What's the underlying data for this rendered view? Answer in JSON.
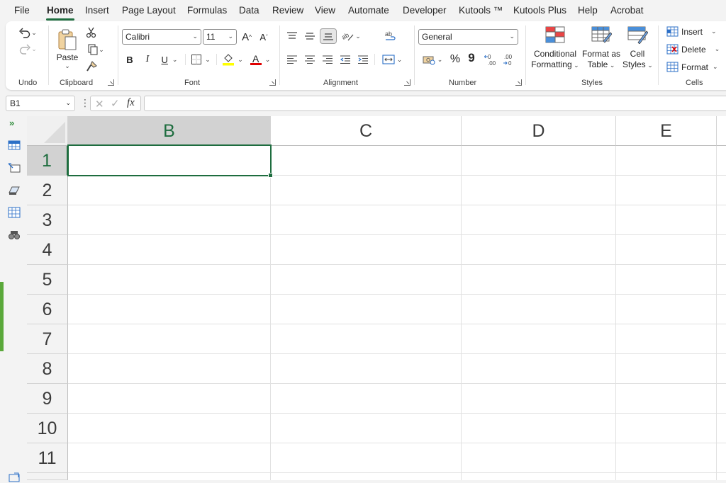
{
  "menu": {
    "tabs": [
      "File",
      "Home",
      "Insert",
      "Page Layout",
      "Formulas",
      "Data",
      "Review",
      "View",
      "Automate",
      "Developer",
      "Kutools ™",
      "Kutools Plus",
      "Help",
      "Acrobat"
    ],
    "active": "Home"
  },
  "ribbon": {
    "groups": {
      "undo": "Undo",
      "clipboard": "Clipboard",
      "font": "Font",
      "alignment": "Alignment",
      "number": "Number",
      "styles": "Styles",
      "cells": "Cells"
    },
    "clipboard": {
      "paste_label": "Paste"
    },
    "font": {
      "name": "Calibri",
      "size": "11",
      "bold": "B",
      "italic": "I",
      "underline": "U",
      "grow": "A",
      "shrink": "A",
      "font_color_letter": "A"
    },
    "number": {
      "format": "General",
      "percent": "%",
      "comma": "9",
      "inc_decimal": "←0\n.00",
      "dec_decimal": ".00\n→0"
    },
    "styles": {
      "conditional_formatting": [
        "Conditional",
        "Formatting"
      ],
      "format_as_table": [
        "Format as",
        "Table"
      ],
      "cell_styles": [
        "Cell",
        "Styles"
      ]
    },
    "cells": {
      "insert": "Insert",
      "delete": "Delete",
      "format": "Format"
    }
  },
  "formula_bar": {
    "name_box": "B1",
    "fx_label": "fx",
    "formula_value": ""
  },
  "grid": {
    "columns": [
      "B",
      "C",
      "D",
      "E"
    ],
    "rows": [
      "1",
      "2",
      "3",
      "4",
      "5",
      "6",
      "7",
      "8",
      "9",
      "10",
      "11"
    ],
    "selected_column": "B",
    "selected_row": "1"
  },
  "colors": {
    "accent_green": "#1e6d3f",
    "kutools_green": "#5aa83a",
    "highlight_yellow": "#ffff00",
    "font_red": "#e00000"
  }
}
